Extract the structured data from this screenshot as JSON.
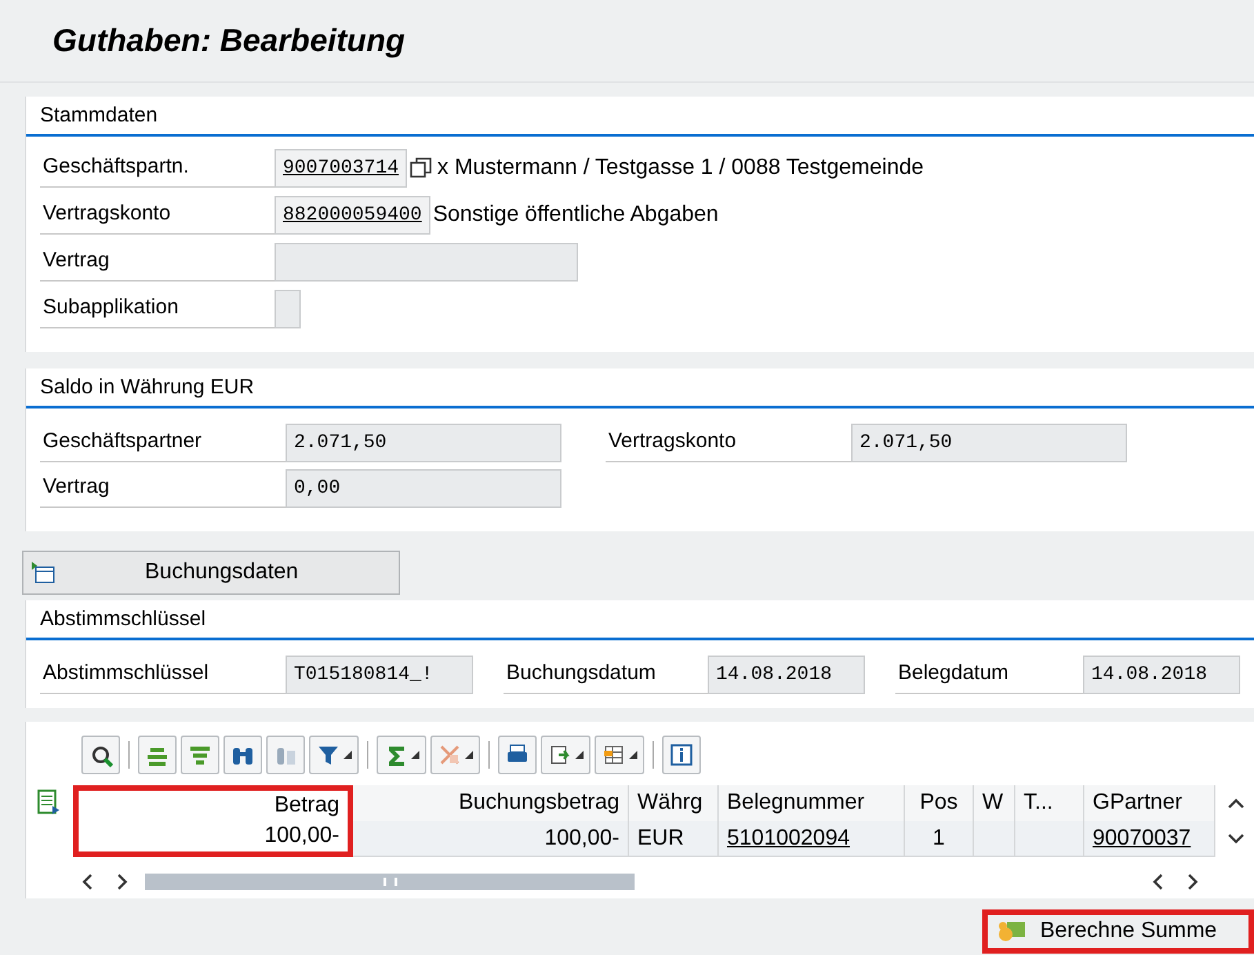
{
  "title": "Guthaben: Bearbeitung",
  "stammdaten": {
    "heading": "Stammdaten",
    "rows": [
      {
        "label": "Geschäftspartn.",
        "kind": "link_field",
        "value": "9007003714",
        "copy_button": true,
        "description": "x Mustermann / Testgasse 1 / 0088 Testgemeinde"
      },
      {
        "label": "Vertragskonto",
        "kind": "link_field",
        "value": "882000059400",
        "copy_button": false,
        "description": "Sonstige öffentliche Abgaben"
      },
      {
        "label": "Vertrag",
        "kind": "empty_field",
        "copy_button": false
      },
      {
        "label": "Subapplikation",
        "kind": "small_field",
        "copy_button": false
      }
    ]
  },
  "saldo": {
    "heading": "Saldo in Währung EUR",
    "fields": [
      {
        "label": "Geschäftspartner",
        "value": "2.071,50"
      },
      {
        "label": "Vertragskonto",
        "value": "2.071,50"
      },
      {
        "label": "Vertrag",
        "value": "0,00"
      }
    ]
  },
  "buchungsdaten_button": "Buchungsdaten",
  "abstimmung": {
    "heading": "Abstimmschlüssel",
    "fields": [
      {
        "label": "Abstimmschlüssel",
        "value": "T015180814_!"
      },
      {
        "label": "Buchungsdatum",
        "value": "14.08.2018"
      },
      {
        "label": "Belegdatum",
        "value": "14.08.2018"
      }
    ]
  },
  "table": {
    "columns": [
      {
        "label": "Betrag",
        "kind": "number",
        "highlighted": true
      },
      {
        "label": "Buchungsbetrag",
        "kind": "number",
        "highlighted": false
      },
      {
        "label": "Währg",
        "kind": "text",
        "highlighted": false
      },
      {
        "label": "Belegnummer",
        "kind": "link",
        "highlighted": false
      },
      {
        "label": "Pos",
        "kind": "center",
        "highlighted": false
      },
      {
        "label": "W",
        "kind": "text",
        "highlighted": false
      },
      {
        "label": "T...",
        "kind": "text",
        "highlighted": false
      },
      {
        "label": "GPartner",
        "kind": "link",
        "highlighted": false
      }
    ],
    "rows": [
      {
        "cells": [
          "100,00-",
          "100,00-",
          "EUR",
          "5101002094",
          "1",
          "",
          "",
          "90070037"
        ]
      }
    ]
  },
  "sum_button": {
    "label": "Berechne Summe",
    "highlighted": true
  }
}
